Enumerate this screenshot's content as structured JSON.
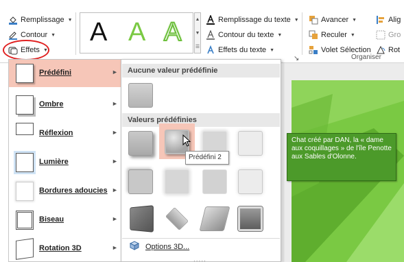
{
  "ribbon": {
    "fill_label": "Remplissage",
    "outline_label": "Contour",
    "effects_label": "Effets",
    "wordart_letters": [
      "A",
      "A",
      "A"
    ],
    "text_fill_label": "Remplissage du texte",
    "text_outline_label": "Contour du texte",
    "text_effects_label": "Effets du texte",
    "bring_forward_label": "Avancer",
    "send_backward_label": "Reculer",
    "selection_pane_label": "Volet Sélection",
    "align_label": "Alig",
    "group_label": "Gro",
    "rotate_label": "Rot",
    "arrange_group_label": "Organiser"
  },
  "effects_menu": {
    "items": [
      {
        "label": "Prédéfini",
        "active": true
      },
      {
        "label": "Ombre",
        "active": false
      },
      {
        "label": "Réflexion",
        "active": false
      },
      {
        "label": "Lumière",
        "active": false
      },
      {
        "label": "Bordures adoucies",
        "active": false
      },
      {
        "label": "Biseau",
        "active": false
      },
      {
        "label": "Rotation 3D",
        "active": false
      }
    ]
  },
  "presets": {
    "no_preset_heading": "Aucune valeur prédéfinie",
    "presets_heading": "Valeurs prédéfinies",
    "tooltip": "Prédéfini 2",
    "options_3d_label": "Options 3D...",
    "grip": "....."
  },
  "slide": {
    "callout_text": "Chat créé par DAN, la « dame aux coquillages » de l'île Penotte aux Sables d'Olonne."
  },
  "colors": {
    "accent_highlight": "#f6c6b8",
    "slide_green": "#7ac943",
    "callout_green": "#4c9a2a",
    "annotation_red": "#e02020"
  }
}
